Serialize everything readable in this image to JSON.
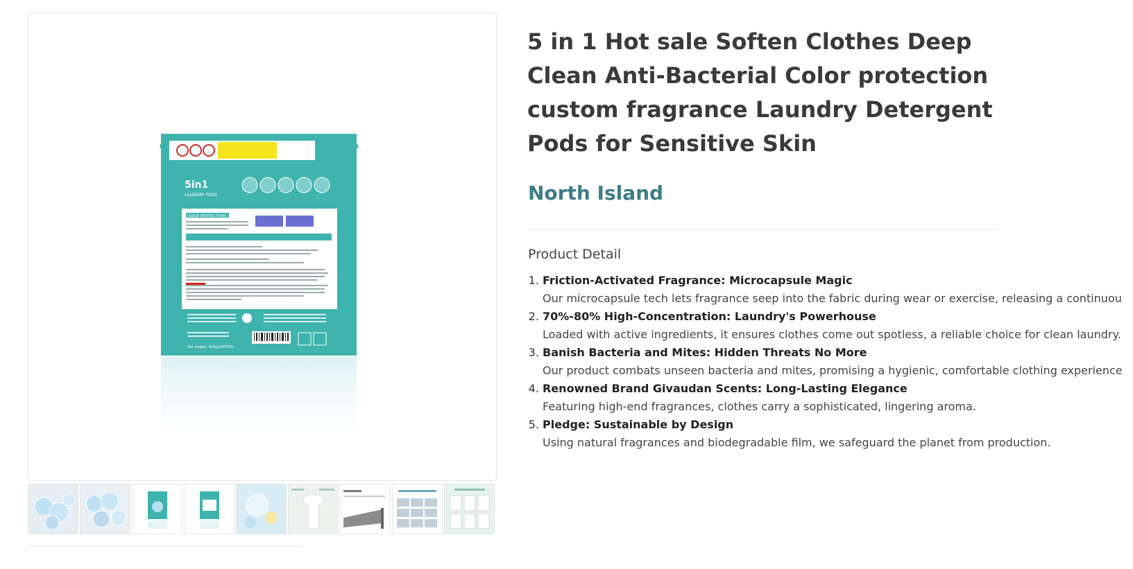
{
  "product": {
    "title": "5 in 1 Hot sale Soften Clothes Deep Clean Anti-Bacterial Color protection custom fragrance Laundry Detergent Pods for Sensitive Skin",
    "brand": "North Island"
  },
  "pouch": {
    "brand_text": "5in1",
    "sub_text": "LAUNDRY PODS",
    "usage_heading": "USAGE INSTRUCTIONS",
    "net_weight": "Net weight: 400g(20PODS)"
  },
  "gallery": {
    "thumbnails": [
      {
        "icon": "pods-image"
      },
      {
        "icon": "pods-image"
      },
      {
        "icon": "pouch-front-image"
      },
      {
        "icon": "pouch-back-image"
      },
      {
        "icon": "bubbles-image"
      },
      {
        "icon": "shirt-image"
      },
      {
        "icon": "givaudan-image"
      },
      {
        "icon": "production-process-image"
      },
      {
        "icon": "certificates-image"
      }
    ]
  },
  "detail": {
    "heading": "Product Detail",
    "features": [
      {
        "title": "Friction-Activated Fragrance: Microcapsule Magic",
        "desc": "Our microcapsule tech lets fragrance seep into the fabric during wear or exercise, releasing a continuou"
      },
      {
        "title": "70%-80% High-Concentration: Laundry's Powerhouse",
        "desc": "Loaded with active ingredients, it ensures clothes come out spotless, a reliable choice for clean laundry."
      },
      {
        "title": "Banish Bacteria and Mites: Hidden Threats No More",
        "desc": "Our product combats unseen bacteria and mites, promising a hygienic, comfortable clothing experience"
      },
      {
        "title": "Renowned Brand Givaudan Scents: Long-Lasting Elegance",
        "desc": "Featuring high-end fragrances, clothes carry a sophisticated, lingering aroma."
      },
      {
        "title": "Pledge: Sustainable by Design",
        "desc": "Using natural fragrances and biodegradable film, we safeguard the planet from production."
      }
    ]
  },
  "colors": {
    "brand": "#3d7d87",
    "pouch_teal": "#3fb3ad"
  }
}
